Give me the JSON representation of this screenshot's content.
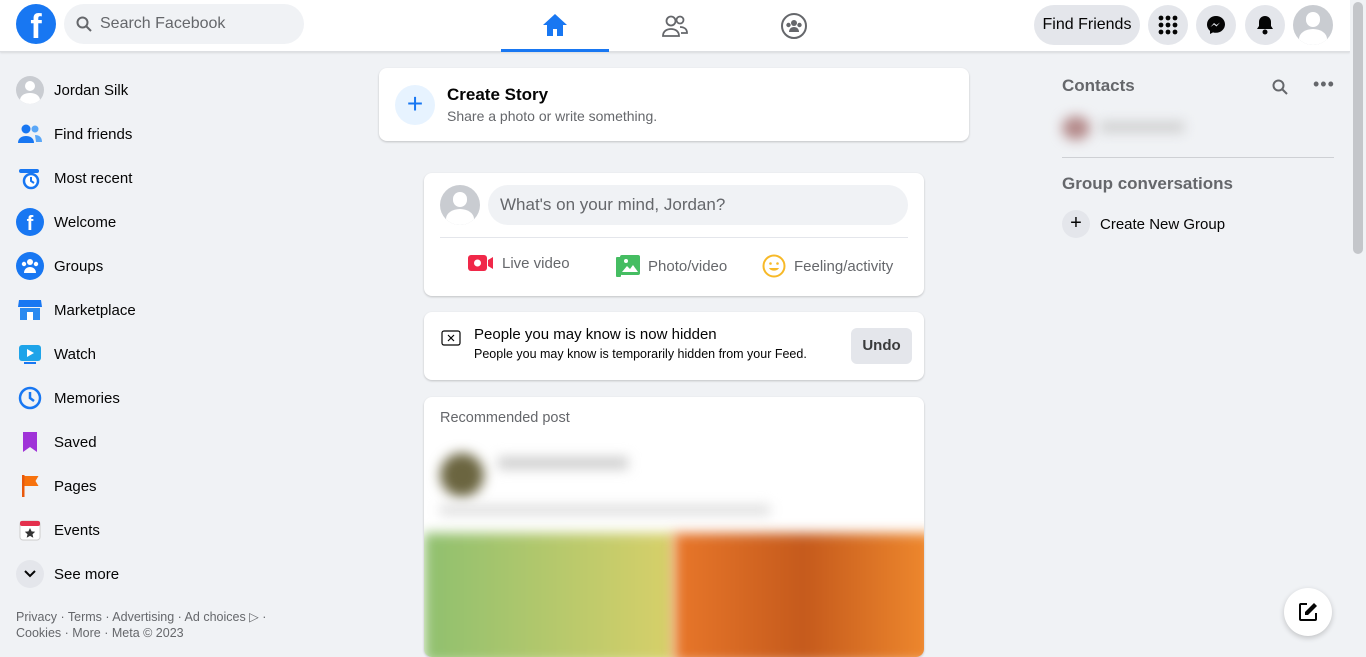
{
  "header": {
    "search_placeholder": "Search Facebook",
    "find_friends": "Find Friends",
    "nav": [
      "home-icon",
      "friends-icon",
      "groups-icon"
    ],
    "brand_color": "#1877f2"
  },
  "sidebar": {
    "items": [
      {
        "label": "Jordan Silk",
        "icon": "avatar"
      },
      {
        "label": "Find friends",
        "icon": "friends-icon"
      },
      {
        "label": "Most recent",
        "icon": "most-recent-icon"
      },
      {
        "label": "Welcome",
        "icon": "facebook-icon"
      },
      {
        "label": "Groups",
        "icon": "groups-icon"
      },
      {
        "label": "Marketplace",
        "icon": "marketplace-icon"
      },
      {
        "label": "Watch",
        "icon": "watch-icon"
      },
      {
        "label": "Memories",
        "icon": "memories-icon"
      },
      {
        "label": "Saved",
        "icon": "saved-icon"
      },
      {
        "label": "Pages",
        "icon": "pages-icon"
      },
      {
        "label": "Events",
        "icon": "events-icon"
      },
      {
        "label": "See more",
        "icon": "chevron-down-icon"
      }
    ],
    "footer_line1": "Privacy · Terms · Advertising · Ad choices ▷ ·",
    "footer_line2": "Cookies · More · Meta © 2023"
  },
  "story": {
    "title": "Create Story",
    "subtitle": "Share a photo or write something."
  },
  "composer": {
    "placeholder": "What's on your mind, Jordan?",
    "live": "Live video",
    "photo": "Photo/video",
    "feeling": "Feeling/activity"
  },
  "notice": {
    "title": "People you may know is now hidden",
    "subtitle": "People you may know is temporarily hidden from your Feed.",
    "undo": "Undo"
  },
  "post": {
    "label": "Recommended post"
  },
  "contacts": {
    "title": "Contacts",
    "group_title": "Group conversations",
    "create_group": "Create New Group"
  }
}
